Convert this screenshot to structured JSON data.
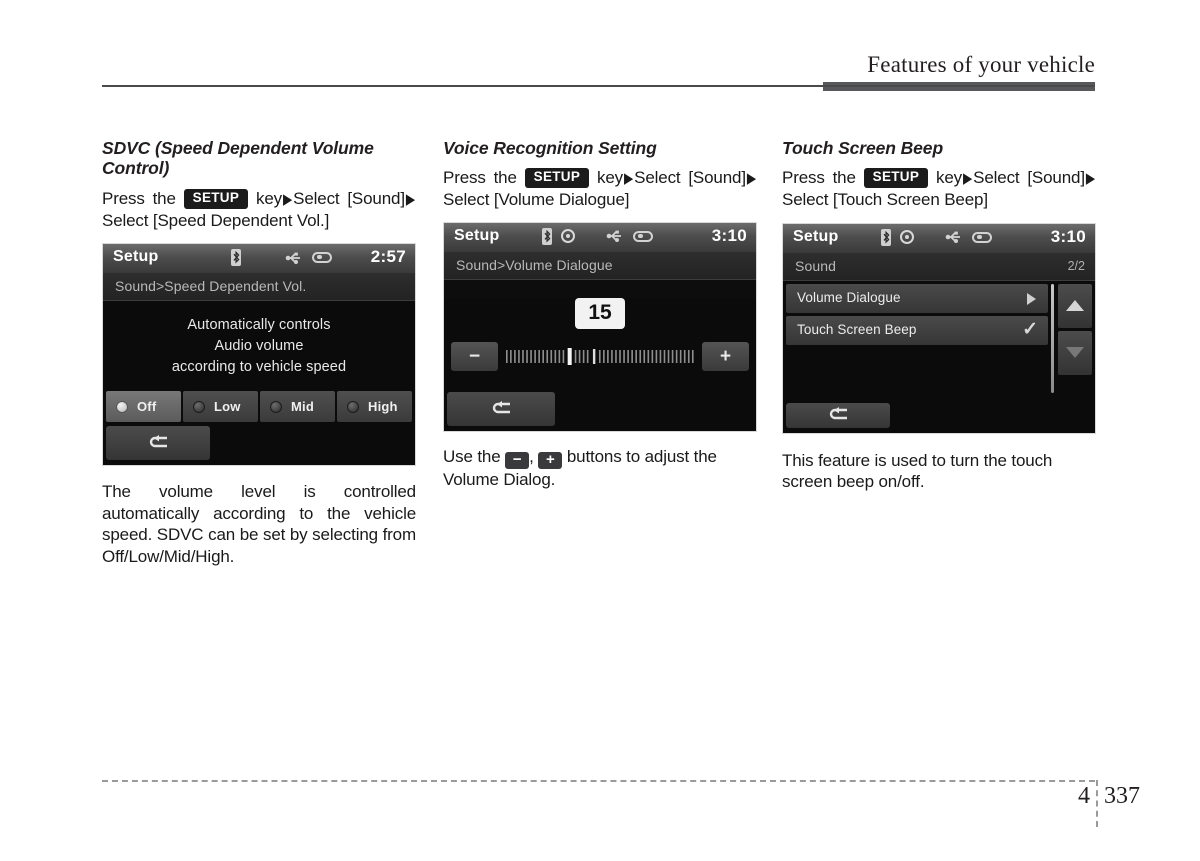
{
  "header": {
    "title": "Features of your vehicle"
  },
  "footer": {
    "chapter": "4",
    "page": "337"
  },
  "columns": [
    {
      "id": "sdvc",
      "title": "SDVC (Speed Dependent Volume Control)",
      "instruction": {
        "pre": "Press the",
        "key": "SETUP",
        "mid": "key",
        "after_arrow_1": "Select [Sound]",
        "after_arrow_2": "Select [Speed Dependent Vol.]"
      },
      "caption": "The volume level is controlled automatically according to the vehicle speed. SDVC can be set by selecting from Off/Low/Mid/High.",
      "device": {
        "title": "Setup",
        "clock": "2:57",
        "breadcrumb": "Sound>Speed Dependent Vol.",
        "message_lines": [
          "Automatically controls",
          "Audio volume",
          "according to vehicle speed"
        ],
        "options": [
          {
            "label": "Off",
            "selected": true
          },
          {
            "label": "Low",
            "selected": false
          },
          {
            "label": "Mid",
            "selected": false
          },
          {
            "label": "High",
            "selected": false
          }
        ],
        "status_icons": [
          "bluetooth-icon",
          "usb-icon",
          "oval-icon"
        ],
        "back_icon": "back-arrow-icon"
      }
    },
    {
      "id": "voice-recognition",
      "title": "Voice Recognition Setting",
      "instruction": {
        "pre": "Press the",
        "key": "SETUP",
        "mid": "key",
        "after_arrow_1": "Select [Sound]",
        "after_arrow_2": "Select [Volume Dialogue]"
      },
      "caption_pre": "Use the",
      "caption_minus": "−",
      "caption_comma": ",",
      "caption_plus": "+",
      "caption_post": "buttons to adjust the Volume Dialog.",
      "device": {
        "title": "Setup",
        "clock": "3:10",
        "breadcrumb": "Sound>Volume Dialogue",
        "value": "15",
        "minus_label": "−",
        "plus_label": "+",
        "status_icons": [
          "bluetooth-icon",
          "disc-icon",
          "usb-icon",
          "oval-icon"
        ],
        "back_icon": "back-arrow-icon"
      }
    },
    {
      "id": "touch-screen-beep",
      "title": "Touch Screen Beep",
      "instruction": {
        "pre": "Press the",
        "key": "SETUP",
        "mid": "key",
        "after_arrow_1": "Select [Sound]",
        "after_arrow_2": "Select [Touch Screen Beep]"
      },
      "caption": "This feature is used to turn the touch screen beep on/off.",
      "device": {
        "title": "Setup",
        "clock": "3:10",
        "breadcrumb": "Sound",
        "page_indicator": "2/2",
        "rows": [
          {
            "label": "Volume Dialogue",
            "marker": "chevron-right-icon"
          },
          {
            "label": "Touch Screen Beep",
            "marker": "check-icon"
          }
        ],
        "status_icons": [
          "bluetooth-icon",
          "disc-icon",
          "usb-icon",
          "oval-icon"
        ],
        "scroll_up_icon": "arrow-up-icon",
        "scroll_down_icon": "arrow-down-icon",
        "back_icon": "back-arrow-icon"
      }
    }
  ]
}
